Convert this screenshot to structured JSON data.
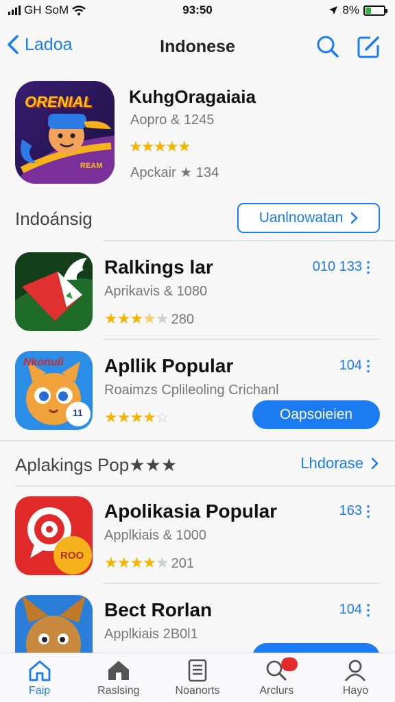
{
  "status": {
    "carrier": "GH SoM",
    "time": "93:50",
    "battery": "8%"
  },
  "nav": {
    "back_label": "Ladoa",
    "title": "Indonese"
  },
  "featured": {
    "name": "KuhgOragaiaia",
    "subtitle": "Aopro & 1245",
    "stars": "★★★★★",
    "meta": "Apckair ★ 134",
    "icon_text": "ORENIAL",
    "icon_tag": "REAM"
  },
  "section1": {
    "title": "Indoánsig",
    "link_label": "Uanlnowatan"
  },
  "section2": {
    "title": "Aplakings Pop★★★",
    "link_label": "Lhdorase"
  },
  "apps": [
    {
      "name": "Ralkings lar",
      "subtitle": "Aprikavis & 1080",
      "stars_on": "★★★",
      "stars_half": "★",
      "stars_off": "★",
      "rating": "280",
      "count": "010 133",
      "more": "⋮"
    },
    {
      "name": "Apllik Popular",
      "subtitle": "Roaimzs Cplileoling Crichanl",
      "stars_on": "★★★★",
      "stars_off": "☆",
      "button_label": "Oapsoieien",
      "count": "104",
      "more": "⋮",
      "icon_text": "Nkonuli",
      "icon_badge": "11"
    },
    {
      "name": "Apolikasia Popular",
      "subtitle": "Applkiais & 1000",
      "stars_on": "★★★★",
      "stars_off": "★",
      "rating": "201",
      "count": "163",
      "more": "⋮",
      "icon_text": "ROO"
    },
    {
      "name": "Bect Rorlan",
      "subtitle": "Applkiais 2B0l1",
      "count": "104",
      "more": "⋮"
    }
  ],
  "tabs": [
    {
      "label": "Faip",
      "icon": "house-icon",
      "active": true
    },
    {
      "label": "Raslsing",
      "icon": "home-filled-icon"
    },
    {
      "label": "Noanorts",
      "icon": "document-icon"
    },
    {
      "label": "Arclurs",
      "icon": "search-icon"
    },
    {
      "label": "Hayo",
      "icon": "person-icon"
    }
  ],
  "colors": {
    "accent": "#1a7cf0",
    "star": "#f4b400",
    "badge": "#e32b2b"
  }
}
